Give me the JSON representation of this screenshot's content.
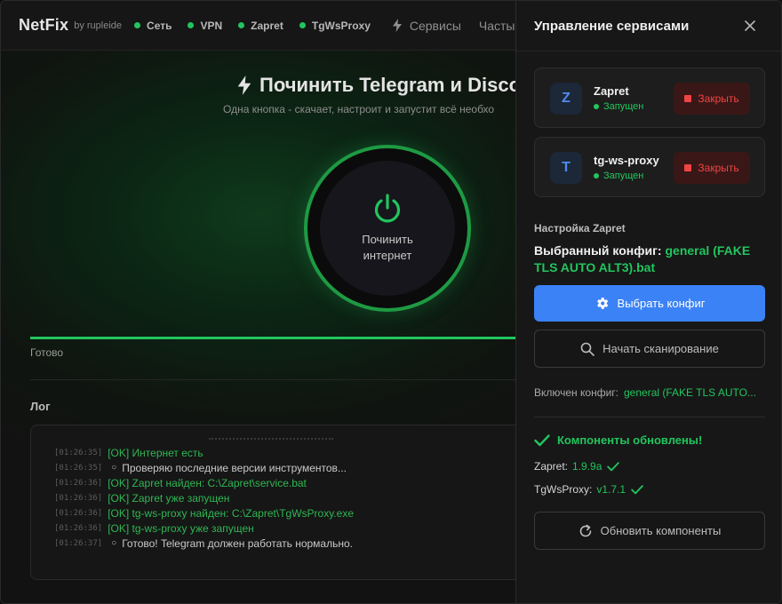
{
  "app": {
    "brand": "NetFix",
    "brand_by": "by rupleide"
  },
  "status_bar": {
    "items": [
      "Сеть",
      "VPN",
      "Zapret",
      "TgWsProxy"
    ],
    "color": "#22c55e"
  },
  "nav": {
    "services_label": "Сервисы",
    "faq_label": "Частые в"
  },
  "hero": {
    "title": "Починить Telegram и Disco",
    "subtitle": "Одна кнопка - скачает, настроит и запустит всё необхо",
    "power_label": "Починить интернет"
  },
  "progress": {
    "value": 1.0,
    "status": "Готово"
  },
  "log": {
    "title": "Лог",
    "lines": [
      {
        "time": "[01:26:35]",
        "type": "ok",
        "text": "[OK] Интернет есть"
      },
      {
        "time": "[01:26:35]",
        "type": "info",
        "text": "Проверяю последние версии инструментов..."
      },
      {
        "time": "[01:26:36]",
        "type": "ok",
        "text": "[OK] Zapret найден: C:\\Zapret\\service.bat"
      },
      {
        "time": "[01:26:36]",
        "type": "ok",
        "text": "[OK] Zapret уже запущен"
      },
      {
        "time": "[01:26:36]",
        "type": "ok",
        "text": "[OK] tg-ws-proxy найден: C:\\Zapret\\TgWsProxy.exe"
      },
      {
        "time": "[01:26:36]",
        "type": "ok",
        "text": "[OK] tg-ws-proxy уже запущен"
      },
      {
        "time": "[01:26:37]",
        "type": "info",
        "text": "Готово! Telegram должен работать нормально."
      }
    ]
  },
  "panel": {
    "title": "Управление сервисами",
    "services": [
      {
        "letter": "Z",
        "name": "Zapret",
        "state": "Запущен",
        "action": "Закрыть"
      },
      {
        "letter": "T",
        "name": "tg-ws-proxy",
        "state": "Запущен",
        "action": "Закрыть"
      }
    ],
    "config_heading": "Настройка Zapret",
    "selected_prefix": "Выбранный конфиг:",
    "selected_value": "general (FAKE TLS AUTO ALT3).bat",
    "choose_config": "Выбрать конфиг",
    "start_scan": "Начать сканирование",
    "enabled_prefix": "Включен конфиг:",
    "enabled_value": "general (FAKE TLS AUTO...",
    "updated_title": "Компоненты обновлены!",
    "versions": [
      {
        "label": "Zapret:",
        "value": "1.9.9a"
      },
      {
        "label": "TgWsProxy:",
        "value": "v1.7.1"
      }
    ],
    "update_button": "Обновить компоненты"
  },
  "colors": {
    "accent_green": "#22c55e",
    "accent_blue": "#3b82f6",
    "danger_red": "#ef4444"
  }
}
